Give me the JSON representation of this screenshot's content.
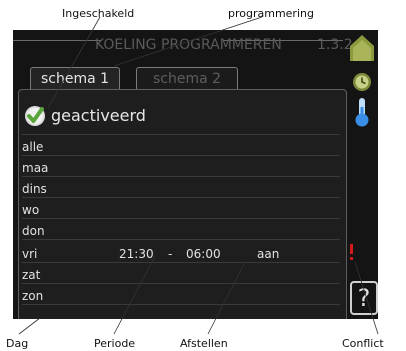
{
  "callouts": {
    "enabled": "Ingeschakeld",
    "programming": "programmering",
    "day": "Dag",
    "period": "Periode",
    "adjust": "Afstellen",
    "conflict": "Conflict"
  },
  "header": {
    "title": "KOELING PROGRAMMEREN",
    "menu_code": "1.3.2"
  },
  "tabs": [
    {
      "label": "schema 1",
      "active": true
    },
    {
      "label": "schema 2",
      "active": false
    }
  ],
  "schedule": {
    "activated_label": "geactiveerd",
    "days": [
      "alle",
      "maa",
      "dins",
      "wo",
      "don",
      "vri",
      "zat",
      "zon"
    ],
    "entries": [
      {
        "day": "vri",
        "start": "21:30",
        "separator": "-",
        "end": "06:00",
        "setting": "aan",
        "conflict": true
      }
    ]
  },
  "icons": {
    "checkbox": "check-icon",
    "menu": "house-icon",
    "clock": "clock-icon",
    "thermometer": "thermometer-icon",
    "help": "help-icon",
    "conflict": "exclamation-icon"
  },
  "help": {
    "label": "?"
  },
  "colors": {
    "check_green": "#5aa43a",
    "house_green": "#8c9a3e",
    "conflict_red": "#d21a1a",
    "thermo_blue": "#3a8ee6"
  }
}
